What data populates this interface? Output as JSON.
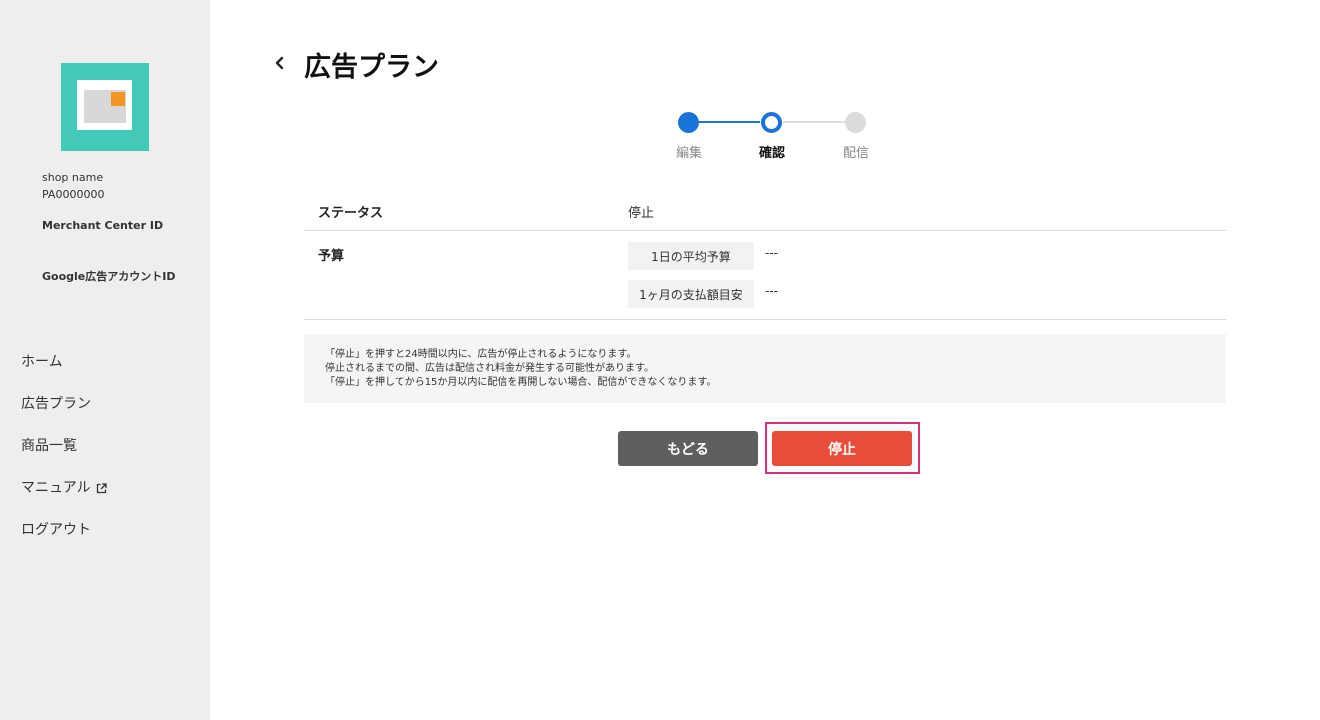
{
  "sidebar": {
    "shop_name": "shop name",
    "shop_id": "PA0000000",
    "merchant_center_label": "Merchant Center ID",
    "google_ads_label": "Google広告アカウントID",
    "nav": {
      "home": "ホーム",
      "ad_plan": "広告プラン",
      "products": "商品一覧",
      "manual": "マニュアル",
      "logout": "ログアウト"
    }
  },
  "header": {
    "title": "広告プラン"
  },
  "stepper": {
    "steps": [
      "編集",
      "確認",
      "配信"
    ],
    "current_index": 1
  },
  "table": {
    "status_label": "ステータス",
    "status_value": "停止",
    "budget_label": "予算",
    "daily_budget_label": "1日の平均予算",
    "daily_budget_value": "---",
    "monthly_budget_label": "1ヶ月の支払額目安",
    "monthly_budget_value": "---"
  },
  "notice": {
    "lines": [
      "「停止」を押すと24時間以内に、広告が停止されるようになります。",
      "停止されるまでの間、広告は配信され料金が発生する可能性があります。",
      "「停止」を押してから15か月以内に配信を再開しない場合、配信ができなくなります。"
    ]
  },
  "buttons": {
    "back_label": "もどる",
    "stop_label": "停止"
  },
  "colors": {
    "accent_blue": "#1a73d9",
    "stop_red": "#e84c3b",
    "back_gray": "#5f5f5f",
    "highlight": "#d6307f",
    "logo_teal": "#43c9b7"
  },
  "icons": {
    "back": "chevron-left-icon",
    "external": "external-link-icon"
  }
}
